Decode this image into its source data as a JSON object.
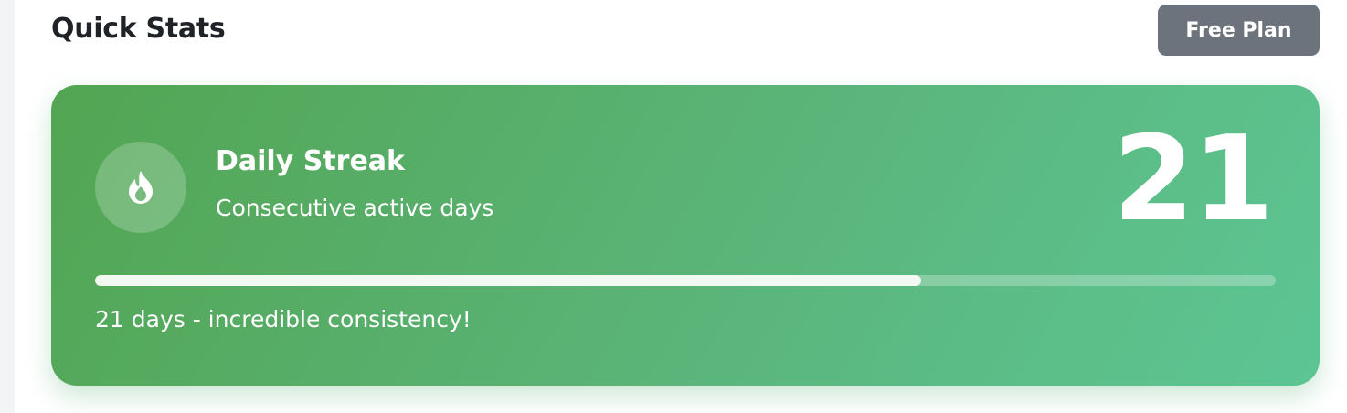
{
  "header": {
    "title": "Quick Stats",
    "plan_label": "Free Plan"
  },
  "streak_card": {
    "icon": "flame-icon",
    "title": "Daily Streak",
    "subtitle": "Consecutive active days",
    "value": "21",
    "progress_fraction": 0.7,
    "caption": "21 days - incredible consistency!"
  },
  "colors": {
    "card_gradient_start": "#52a552",
    "card_gradient_end": "#5cc594",
    "plan_badge": "#6c737c",
    "title_text": "#1f2328"
  }
}
